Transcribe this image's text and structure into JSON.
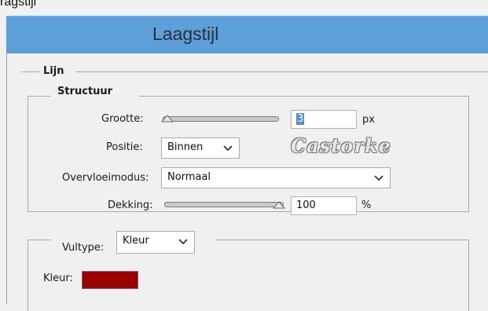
{
  "top_fragment": "ragstijl",
  "window": {
    "title": "Laagstijl"
  },
  "lijn": {
    "legend": "Lijn",
    "structuur": {
      "legend": "Structuur",
      "grootte": {
        "label": "Grootte:",
        "value": "3",
        "unit": "px",
        "slider_fraction": 0.01
      },
      "positie": {
        "label": "Positie:",
        "value": "Binnen"
      },
      "watermark": "Castorke",
      "overvloeimodus": {
        "label": "Overvloeimodus:",
        "value": "Normaal"
      },
      "dekking": {
        "label": "Dekking:",
        "value": "100",
        "unit": "%",
        "slider_fraction": 1.0
      }
    },
    "vultype": {
      "label": "Vultype:",
      "value": "Kleur",
      "kleur": {
        "label": "Kleur:",
        "color": "#990000"
      }
    }
  },
  "colors": {
    "titlebar": "#5c9fd9",
    "selection": "#4d8fd9"
  },
  "icons": {
    "dropdown": "chevron-down-icon",
    "slider": "slider-handle-icon"
  }
}
